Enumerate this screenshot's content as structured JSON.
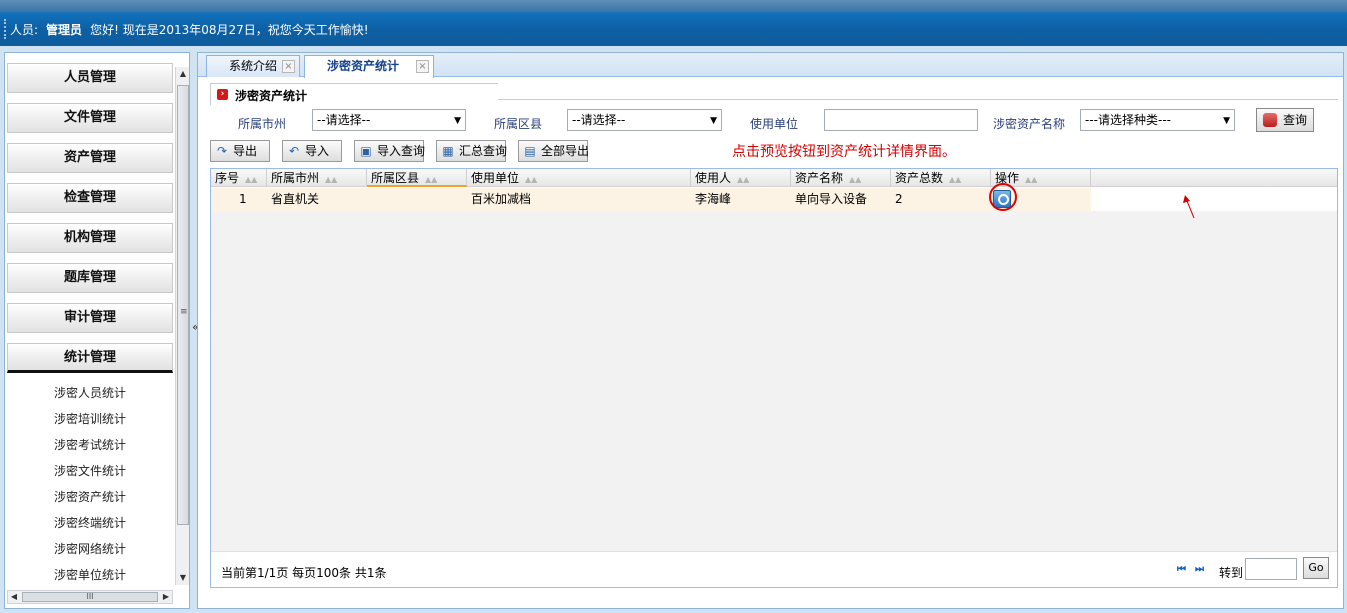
{
  "header": {
    "user_label": "人员:",
    "user_name": "管理员",
    "greeting": "您好!  现在是2013年08月27日，祝您今天工作愉快!"
  },
  "sidebar": {
    "menus": [
      "人员管理",
      "文件管理",
      "资产管理",
      "检查管理",
      "机构管理",
      "题库管理",
      "审计管理",
      "统计管理"
    ],
    "active_menu": "统计管理",
    "sub_items": [
      "涉密人员统计",
      "涉密培训统计",
      "涉密考试统计",
      "涉密文件统计",
      "涉密资产统计",
      "涉密终端统计",
      "涉密网络统计",
      "涉密单位统计"
    ],
    "collapse_glyph": "«"
  },
  "tabs": [
    {
      "label": "系统介绍",
      "active": false
    },
    {
      "label": "涉密资产统计",
      "active": true
    }
  ],
  "panel": {
    "title": "涉密资产统计"
  },
  "filters": {
    "city_label": "所属市州",
    "city_value": "--请选择--",
    "county_label": "所属区县",
    "county_value": "--请选择--",
    "unit_label": "使用单位",
    "unit_value": "",
    "asset_label": "涉密资产名称",
    "asset_value": "---请选择种类---",
    "query_label": "查询"
  },
  "toolbar": {
    "export": "导出",
    "import": "导入",
    "import_query": "导入查询",
    "summary_query": "汇总查询",
    "export_all": "全部导出"
  },
  "annotation": "点击预览按钮到资产统计详情界面。",
  "grid": {
    "columns": [
      "序号",
      "所属市州",
      "所属区县",
      "使用单位",
      "使用人",
      "资产名称",
      "资产总数",
      "操作"
    ],
    "rows": [
      {
        "index": "1",
        "city": "省直机关",
        "county": "",
        "unit": "百米加减档",
        "user": "李海峰",
        "asset": "单向导入设备",
        "total": "2"
      }
    ]
  },
  "pager": {
    "info": "当前第1/1页  每页100条  共1条",
    "first": "⏮",
    "last": "⏭",
    "goto_label": "转到",
    "goto_value": "",
    "go_label": "Go"
  },
  "colors": {
    "annotation": "#d40000",
    "header_bg": "#0f6cb5",
    "row_highlight": "#fdf3e4"
  }
}
